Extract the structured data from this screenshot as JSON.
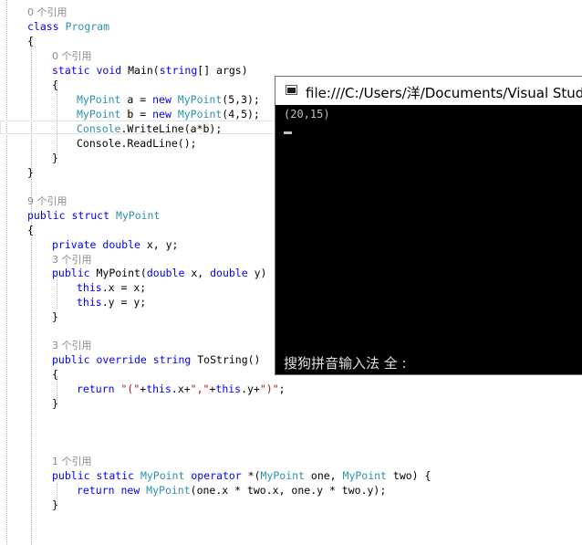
{
  "editor": {
    "lines": [
      [
        {
          "t": "0 个引用",
          "c": "ref"
        }
      ],
      [
        {
          "t": "class ",
          "c": "kw"
        },
        {
          "t": "Program",
          "c": "ty"
        }
      ],
      [
        {
          "t": "{",
          "c": "pl"
        }
      ],
      [
        {
          "t": "0 个引用",
          "c": "ref"
        }
      ],
      [
        {
          "t": "static ",
          "c": "kw"
        },
        {
          "t": "void ",
          "c": "kw"
        },
        {
          "t": "Main(",
          "c": "pl"
        },
        {
          "t": "string",
          "c": "kw"
        },
        {
          "t": "[] args)",
          "c": "pl"
        }
      ],
      [
        {
          "t": "{",
          "c": "pl"
        }
      ],
      [
        {
          "t": "MyPoint",
          "c": "ty"
        },
        {
          "t": " a = ",
          "c": "pl"
        },
        {
          "t": "new ",
          "c": "kw"
        },
        {
          "t": "MyPoint",
          "c": "ty"
        },
        {
          "t": "(5,3);",
          "c": "pl"
        }
      ],
      [
        {
          "t": "MyPoint",
          "c": "ty"
        },
        {
          "t": " ",
          "c": "pl"
        },
        {
          "t": "b",
          "c": "hl"
        },
        {
          "t": " = ",
          "c": "pl"
        },
        {
          "t": "new ",
          "c": "kw"
        },
        {
          "t": "MyPoint",
          "c": "ty"
        },
        {
          "t": "(4,5);",
          "c": "pl"
        }
      ],
      [
        {
          "t": "Console",
          "c": "ty"
        },
        {
          "t": ".WriteLine(a*",
          "c": "pl"
        },
        {
          "t": "b",
          "c": "hl"
        },
        {
          "t": ");",
          "c": "pl"
        }
      ],
      [
        {
          "t": "Console",
          "c": "pl"
        },
        {
          "t": ".ReadLine();",
          "c": "pl"
        }
      ],
      [
        {
          "t": "}",
          "c": "pl"
        }
      ],
      [
        {
          "t": "}",
          "c": "pl"
        }
      ],
      [
        {
          "t": "9 个引用",
          "c": "ref"
        }
      ],
      [
        {
          "t": "public ",
          "c": "kw"
        },
        {
          "t": "struct ",
          "c": "kw"
        },
        {
          "t": "MyPoint",
          "c": "ty"
        }
      ],
      [
        {
          "t": "{",
          "c": "pl"
        }
      ],
      [
        {
          "t": "private ",
          "c": "kw"
        },
        {
          "t": "double ",
          "c": "kw"
        },
        {
          "t": "x, y;",
          "c": "pl"
        }
      ],
      [
        {
          "t": "3 个引用",
          "c": "ref"
        }
      ],
      [
        {
          "t": "public ",
          "c": "kw"
        },
        {
          "t": "MyPoint(",
          "c": "pl"
        },
        {
          "t": "double ",
          "c": "kw"
        },
        {
          "t": "x, ",
          "c": "pl"
        },
        {
          "t": "double ",
          "c": "kw"
        },
        {
          "t": "y)",
          "c": "pl"
        }
      ],
      [
        {
          "t": "this",
          "c": "kw"
        },
        {
          "t": ".x = x;",
          "c": "pl"
        }
      ],
      [
        {
          "t": "this",
          "c": "kw"
        },
        {
          "t": ".y = y;",
          "c": "pl"
        }
      ],
      [
        {
          "t": "}",
          "c": "pl"
        }
      ],
      [
        {
          "t": "3 个引用",
          "c": "ref"
        }
      ],
      [
        {
          "t": "public ",
          "c": "kw"
        },
        {
          "t": "override ",
          "c": "kw"
        },
        {
          "t": "string ",
          "c": "kw"
        },
        {
          "t": "ToString()",
          "c": "pl"
        }
      ],
      [
        {
          "t": "{",
          "c": "pl"
        }
      ],
      [
        {
          "t": "return ",
          "c": "kw"
        },
        {
          "t": "\"(\"",
          "c": "st"
        },
        {
          "t": "+",
          "c": "pl"
        },
        {
          "t": "this",
          "c": "kw"
        },
        {
          "t": ".x+",
          "c": "pl"
        },
        {
          "t": "\",\"",
          "c": "st"
        },
        {
          "t": "+",
          "c": "pl"
        },
        {
          "t": "this",
          "c": "kw"
        },
        {
          "t": ".y+",
          "c": "pl"
        },
        {
          "t": "\")\"",
          "c": "st"
        },
        {
          "t": ";",
          "c": "pl"
        }
      ],
      [
        {
          "t": "}",
          "c": "pl"
        }
      ],
      [
        {
          "t": "1 个引用",
          "c": "ref"
        }
      ],
      [
        {
          "t": "public ",
          "c": "kw"
        },
        {
          "t": "static ",
          "c": "kw"
        },
        {
          "t": "MyPoint ",
          "c": "ty"
        },
        {
          "t": "operator ",
          "c": "kw"
        },
        {
          "t": "*(",
          "c": "pl"
        },
        {
          "t": "MyPoint",
          "c": "ty"
        },
        {
          "t": " one, ",
          "c": "pl"
        },
        {
          "t": "MyPoint",
          "c": "ty"
        },
        {
          "t": " two) {",
          "c": "pl"
        }
      ],
      [
        {
          "t": "return ",
          "c": "kw"
        },
        {
          "t": "new ",
          "c": "kw"
        },
        {
          "t": "MyPoint",
          "c": "ty"
        },
        {
          "t": "(one.x * two.x, one.y * two.y);",
          "c": "pl"
        }
      ],
      [
        {
          "t": "}",
          "c": "pl"
        }
      ]
    ]
  },
  "console": {
    "title": "file:///C:/Users/洋/Documents/Visual Studio",
    "output": "(20,15)",
    "ime_status": "搜狗拼音输入法 全 :"
  }
}
